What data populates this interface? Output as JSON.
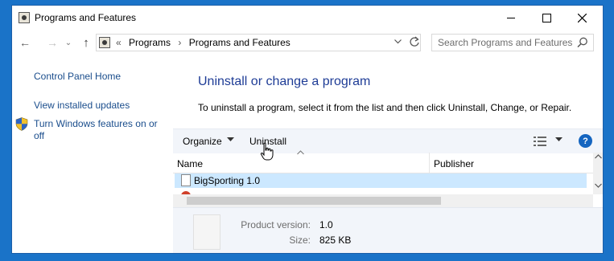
{
  "window": {
    "title": "Programs and Features",
    "controls": {
      "minimize": "minimize",
      "maximize": "maximize",
      "close": "close"
    }
  },
  "nav": {
    "back": "←",
    "forward": "→",
    "recent": "⌄",
    "up": "↑"
  },
  "address": {
    "overflow": "«",
    "segments": [
      "Programs",
      "Programs and Features"
    ],
    "separator": "›"
  },
  "search": {
    "placeholder": "Search Programs and Features"
  },
  "sidebar": {
    "links": {
      "home": "Control Panel Home",
      "updates": "View installed updates",
      "features": "Turn Windows features on or off"
    }
  },
  "main": {
    "heading": "Uninstall or change a program",
    "description": "To uninstall a program, select it from the list and then click Uninstall, Change, or Repair."
  },
  "toolbar": {
    "organize_label": "Organize",
    "uninstall_label": "Uninstall"
  },
  "list": {
    "columns": {
      "name": "Name",
      "publisher": "Publisher"
    },
    "rows": [
      {
        "name": "BigSporting 1.0",
        "publisher": "",
        "selected": true
      }
    ]
  },
  "details": {
    "product_version_label": "Product version:",
    "product_version": "1.0",
    "size_label": "Size:",
    "size": "825 KB"
  },
  "colors": {
    "accent": "#1e3c96",
    "link": "#1a4d8c",
    "selection": "#cce8ff",
    "toolbar_bg": "#f2f5fa",
    "help_blue": "#1565c0"
  },
  "icons": {
    "app": "control-panel-icon",
    "search": "search-icon",
    "shield": "uac-shield-icon",
    "help": "help-icon",
    "cursor": "hand-cursor-icon"
  }
}
